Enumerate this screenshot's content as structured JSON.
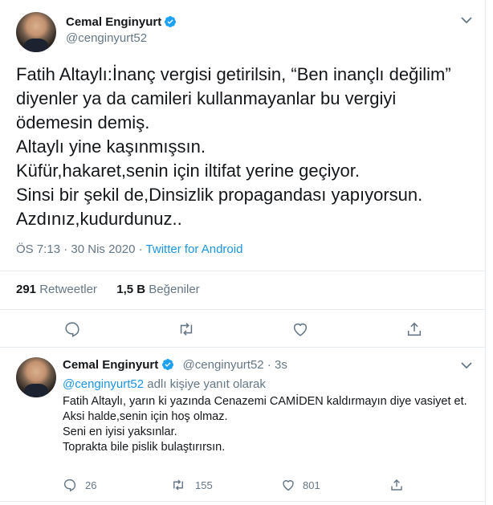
{
  "colors": {
    "accent": "#1b95e0",
    "muted": "#657786",
    "text": "#14171a",
    "divider": "#e6ecf0"
  },
  "icons": {
    "verified": "verified-badge-icon",
    "menu": "chevron-down-icon",
    "reply": "reply-icon",
    "retweet": "retweet-icon",
    "like": "heart-icon",
    "share": "share-icon"
  },
  "main_tweet": {
    "author_name": "Cemal Enginyurt",
    "author_handle": "@cenginyurt52",
    "text": "Fatih Altaylı:İnanç vergisi getirilsin, “Ben inançlı değilim” diyenler ya da camileri kullanmayanlar bu vergiyi ödemesin demiş.\nAltaylı yine kaşınmışsın.\nKüfür,hakaret,senin için iltifat yerine geçiyor.\nSinsi bir şekil de,Dinsizlik propagandası yapıyorsun.\nAzdınız,kudurdunuz..",
    "time": "ÖS 7:13",
    "date": "30 Nis 2020",
    "dot": "·",
    "source": "Twitter for Android",
    "retweets_count": "291",
    "retweets_label": "Retweetler",
    "likes_count": "1,5 B",
    "likes_label": "Beğeniler"
  },
  "reply_tweet": {
    "author_name": "Cemal Enginyurt",
    "author_handle": "@cenginyurt52",
    "age": "· 3s",
    "reply_to_handle": "@cenginyurt52",
    "reply_to_suffix": "adlı kişiye yanıt olarak",
    "text": "Fatih Altaylı, yarın ki yazında Cenazemi CAMİDEN kaldırmayın diye vasiyet et.\nAksi halde,senin için hoş olmaz.\nSeni en iyisi yaksınlar.\nToprakta bile pislik bulaştırırsın.",
    "reply_count": "26",
    "retweet_count": "155",
    "like_count": "801"
  }
}
